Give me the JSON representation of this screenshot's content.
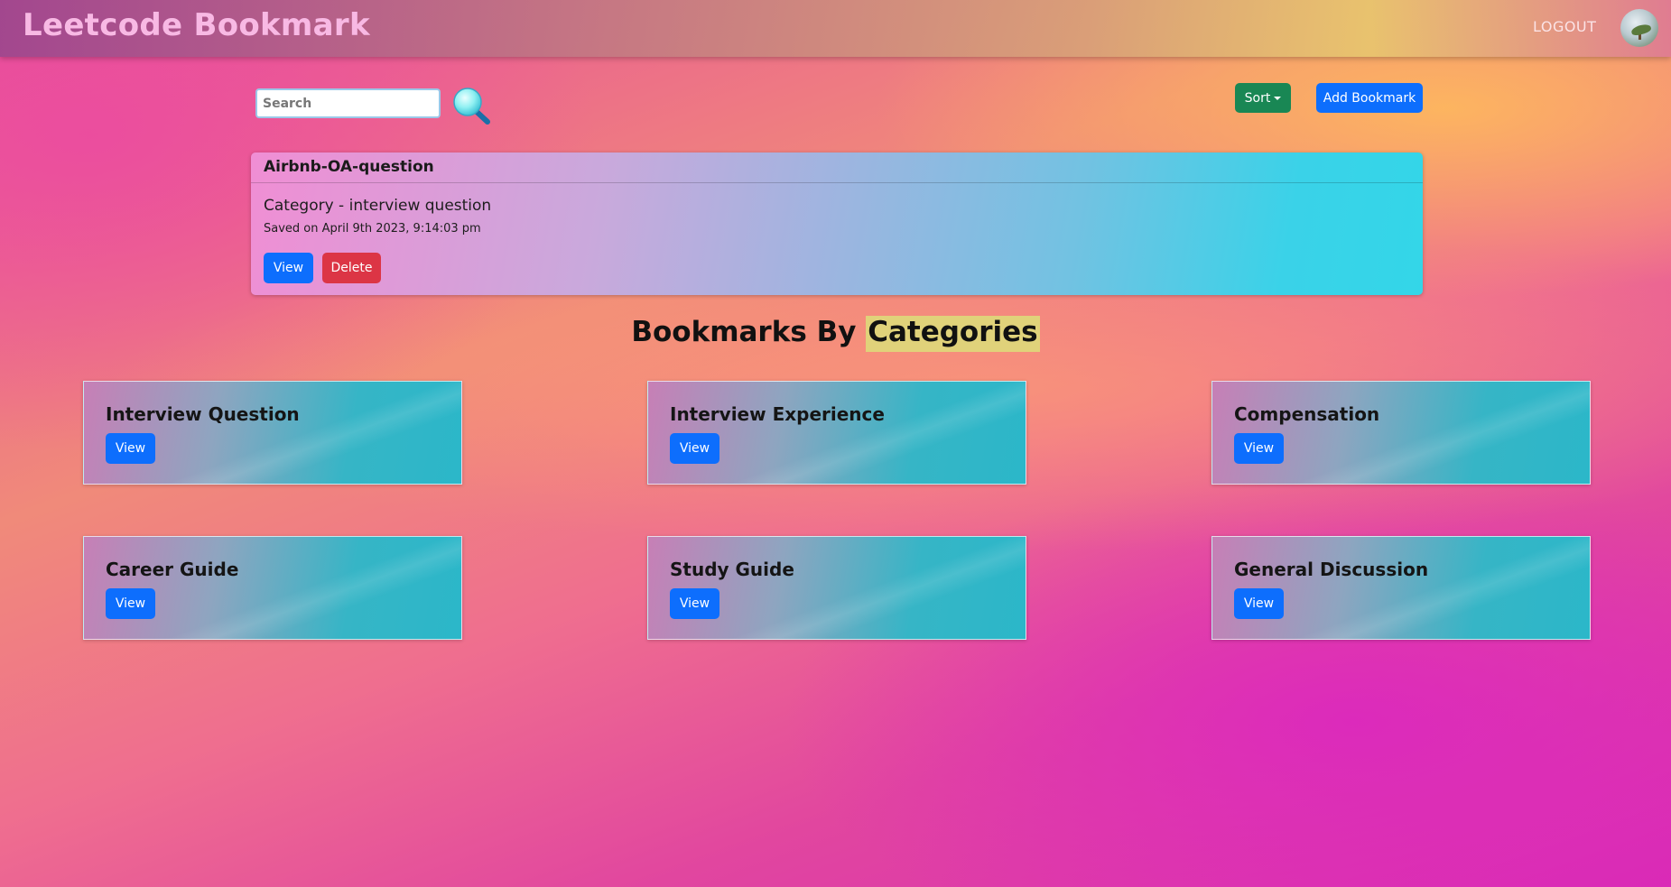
{
  "header": {
    "brand": "Leetcode Bookmark",
    "logout_label": "LOGOUT"
  },
  "toolbar": {
    "search_placeholder": "Search",
    "sort_label": "Sort",
    "add_label": "Add Bookmark"
  },
  "bookmark": {
    "title": "Airbnb-OA-question",
    "category": "Category - interview question",
    "saved": "Saved on April 9th 2023, 9:14:03 pm",
    "view_label": "View",
    "delete_label": "Delete"
  },
  "categories_section": {
    "title_prefix": "Bookmarks By ",
    "title_highlight": "Categories",
    "items": [
      {
        "title": "Interview Question",
        "view_label": "View"
      },
      {
        "title": "Interview Experience",
        "view_label": "View"
      },
      {
        "title": "Compensation",
        "view_label": "View"
      },
      {
        "title": "Career Guide",
        "view_label": "View"
      },
      {
        "title": "Study Guide",
        "view_label": "View"
      },
      {
        "title": "General Discussion",
        "view_label": "View"
      }
    ]
  },
  "colors": {
    "primary": "#0d6efd",
    "success": "#198754",
    "danger": "#dc3545",
    "highlight": "#e0d27a"
  },
  "icons": {
    "search": "search-icon",
    "avatar": "avatar",
    "sort_caret": "caret-down-icon"
  }
}
